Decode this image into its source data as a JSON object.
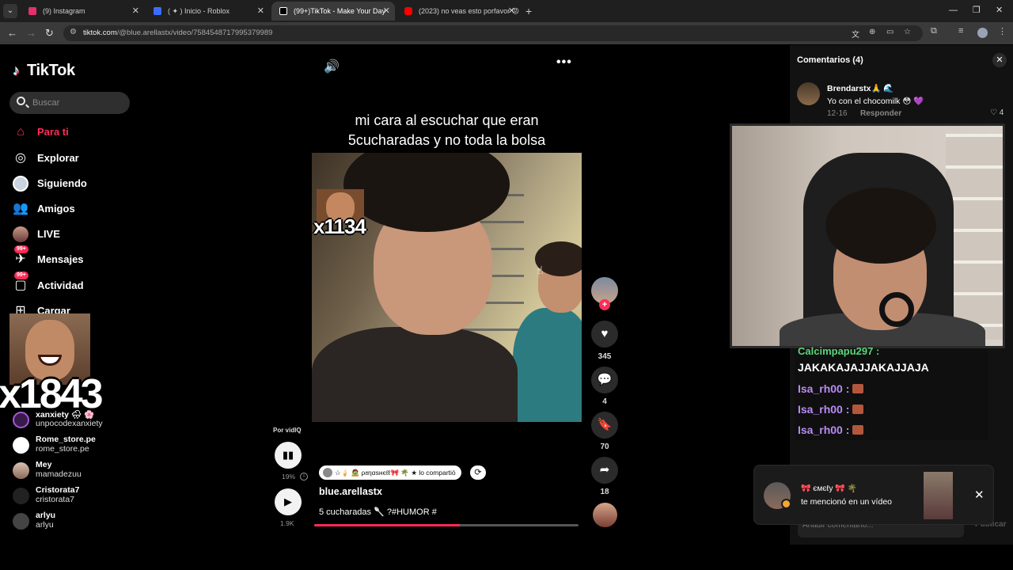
{
  "browser": {
    "tabs": [
      {
        "title": "(9) Instagram",
        "color": "#e1306c"
      },
      {
        "title": "( ✦ ) Inicio - Roblox",
        "color": "#3b6cff"
      },
      {
        "title": "(99+)TikTok - Make Your Day",
        "color": "#222222"
      },
      {
        "title": "(2023) no veas esto porfavor 😡",
        "color": "#ff0000"
      }
    ],
    "new_tab": "+",
    "url_host": "tiktok.com",
    "url_path": "/@blue.arellastx/video/7584548717995379989"
  },
  "sidebar": {
    "logo": "TikTok",
    "search_placeholder": "Buscar",
    "nav": [
      {
        "label": "Para ti",
        "icon": "home-icon"
      },
      {
        "label": "Explorar",
        "icon": "compass-icon"
      },
      {
        "label": "Siguiendo",
        "icon": "following-avatar"
      },
      {
        "label": "Amigos",
        "icon": "friends-icon"
      },
      {
        "label": "LIVE",
        "icon": "live-avatar"
      },
      {
        "label": "Mensajes",
        "icon": "messages-icon",
        "badge": "99+"
      },
      {
        "label": "Actividad",
        "icon": "activity-icon",
        "badge": "99+"
      },
      {
        "label": "Cargar",
        "icon": "upload-icon"
      }
    ],
    "overlay_counter": "x1843",
    "following": [
      {
        "name": "xanxiety 🌧 🌸",
        "user": "unpocodexanxiety"
      },
      {
        "name": "Rome_store.pe",
        "user": "rome_store.pe"
      },
      {
        "name": "Mey",
        "user": "mamadezuu"
      },
      {
        "name": "Cristorata7",
        "user": "cristorata7"
      },
      {
        "name": "arlyu",
        "user": "arlyu"
      }
    ]
  },
  "video": {
    "caption_line1": "mi cara al escuchar que eran",
    "caption_line2": "5cucharadas y no toda la bolsa",
    "overlay_counter": "x1134",
    "likes": "345",
    "comments": "4",
    "saves": "70",
    "shares": "18",
    "shared_by": "☆🍦 🧟 ρ𝔞ηαsнєℓℓ🎀 🌴 ★ lo compartió",
    "author": "blue.arellastx",
    "description": "5 cucharadas 🥄 ?#HUMOR #",
    "progress": 0.55
  },
  "vidiq": {
    "label": "Por vidIQ",
    "score": "19%",
    "views": "1.9K"
  },
  "comments": {
    "title": "Comentarios (4)",
    "items": [
      {
        "name": "Brendarstx🙏 🌊",
        "text": "Yo con el chocomilk 😳 💜",
        "date": "12-16",
        "reply": "Responder",
        "likes": "4"
      }
    ],
    "input_placeholder": "Añadir comentario...",
    "publish": "Publicar"
  },
  "stream_chat": {
    "partial_user": "Calcimpapu297 :",
    "message": "JAKAKAJAJJAKAJJAJA",
    "lines": [
      "Isa_rh00 :",
      "Isa_rh00 :",
      "Isa_rh00 :"
    ]
  },
  "notification": {
    "name": "🎀 ємєℓу 🎀 🌴",
    "text": "te mencionó en un vídeo"
  }
}
